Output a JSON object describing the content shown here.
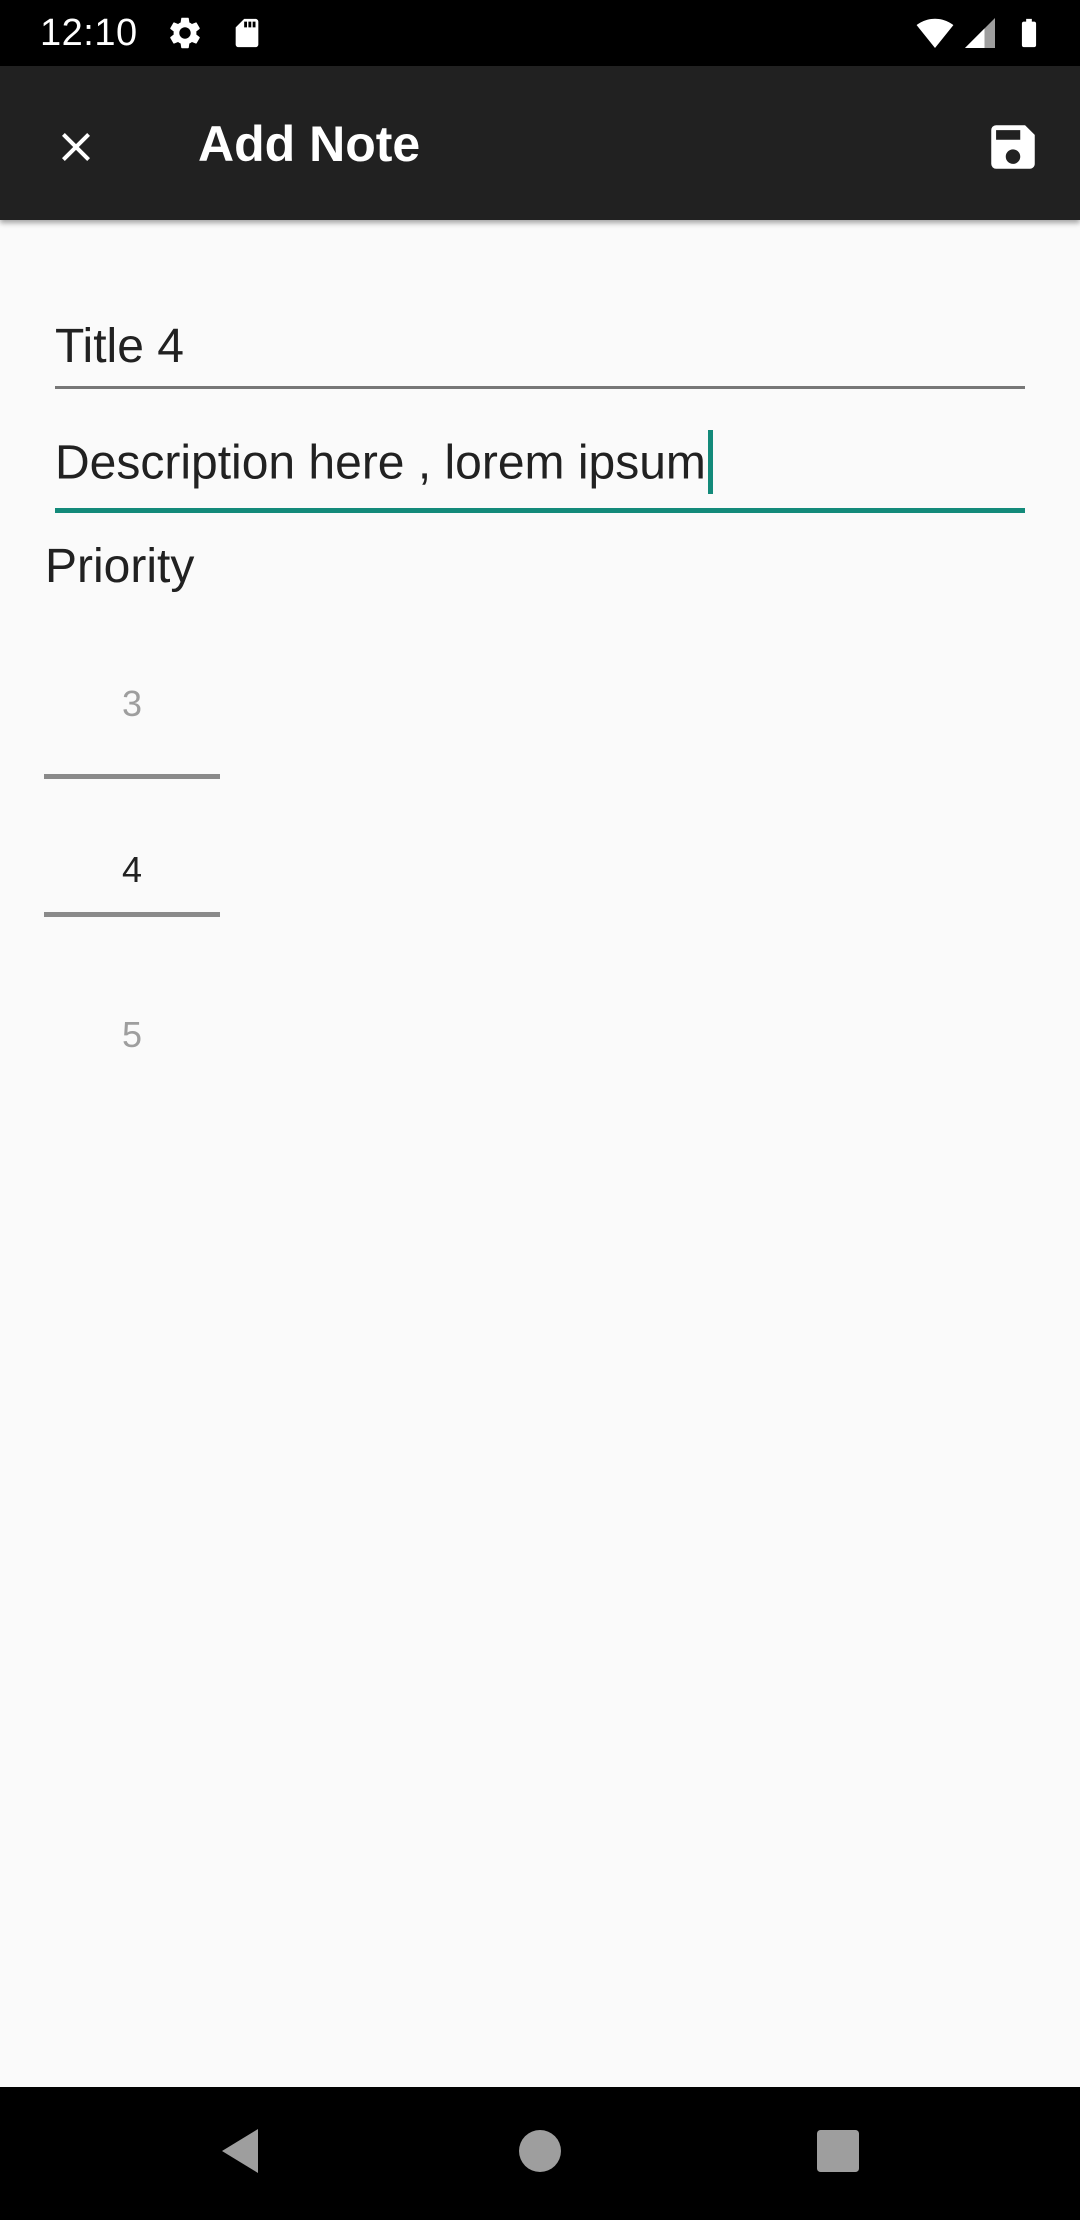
{
  "status_bar": {
    "time": "12:10",
    "icons": [
      "settings-icon",
      "sd-card-icon",
      "wifi-icon",
      "cellular-signal-icon",
      "battery-icon"
    ]
  },
  "app_bar": {
    "title": "Add Note",
    "close_icon": "close-icon",
    "save_icon": "save-icon",
    "background": "#212121"
  },
  "form": {
    "title_value": "Title 4",
    "description_value": "Description here , lorem ipsum",
    "accent_color": "#138a7a"
  },
  "priority": {
    "label": "Priority",
    "visible_values": [
      "3",
      "4",
      "5"
    ],
    "selected": "4"
  },
  "nav_bar": {
    "icons": [
      "back-icon",
      "home-icon",
      "recents-icon"
    ]
  }
}
